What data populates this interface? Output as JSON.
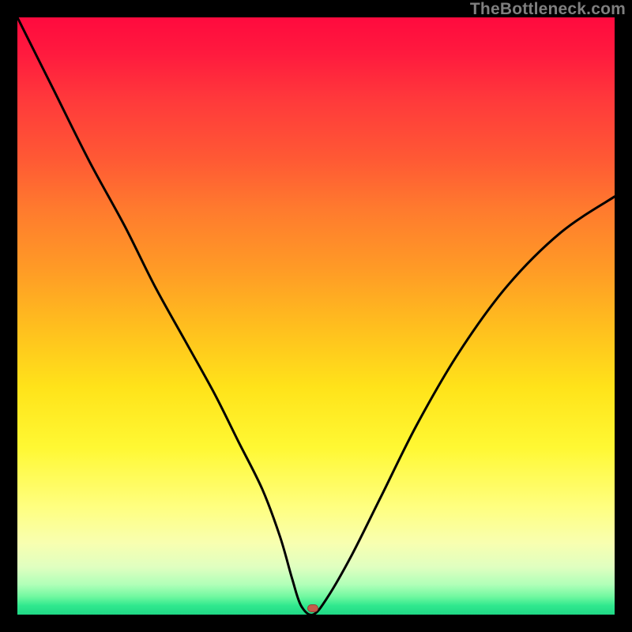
{
  "watermark": "TheBottleneck.com",
  "marker": {
    "x_pct": 49.5,
    "y_pct": 99.0,
    "color": "#c45a4a"
  },
  "chart_data": {
    "type": "line",
    "title": "",
    "xlabel": "",
    "ylabel": "",
    "xlim": [
      0,
      100
    ],
    "ylim": [
      0,
      100
    ],
    "grid": false,
    "legend": false,
    "annotations": [
      {
        "text": "TheBottleneck.com",
        "position": "top-right"
      }
    ],
    "series": [
      {
        "name": "bottleneck-curve",
        "x": [
          0,
          6,
          12,
          18,
          23,
          28,
          33,
          37,
          41,
          44,
          46,
          47.5,
          49.5,
          52,
          56,
          61,
          67,
          74,
          82,
          91,
          100
        ],
        "y": [
          100,
          88,
          76,
          65,
          55,
          46,
          37,
          29,
          21,
          13,
          6,
          1.5,
          0,
          3,
          10,
          20,
          32,
          44,
          55,
          64,
          70
        ]
      }
    ],
    "background_gradient": {
      "direction": "top-to-bottom",
      "stops": [
        {
          "pct": 0,
          "color": "#ff0a3e"
        },
        {
          "pct": 14,
          "color": "#ff3a3b"
        },
        {
          "pct": 32,
          "color": "#ff7a2e"
        },
        {
          "pct": 52,
          "color": "#ffbf1e"
        },
        {
          "pct": 72,
          "color": "#fff833"
        },
        {
          "pct": 88,
          "color": "#f8ffb0"
        },
        {
          "pct": 97,
          "color": "#70f8a0"
        },
        {
          "pct": 100,
          "color": "#20d886"
        }
      ]
    },
    "marker": {
      "x": 49.5,
      "y": 0,
      "color": "#c45a4a",
      "shape": "rounded-rect"
    }
  }
}
